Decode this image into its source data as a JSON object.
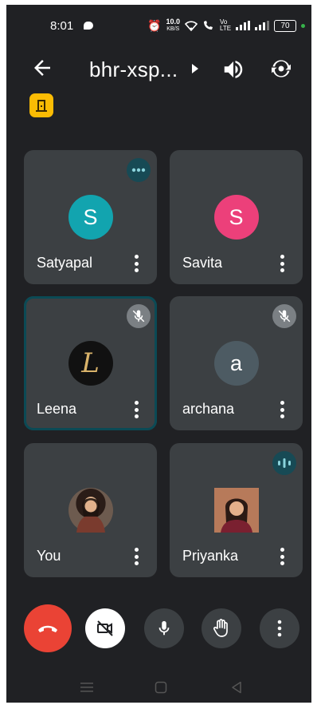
{
  "status_bar": {
    "time": "8:01",
    "net_speed_value": "10.0",
    "net_speed_unit": "KB/S",
    "volte_label": "Vo LTE",
    "battery": "70"
  },
  "header": {
    "meeting_code": "bhr-xsp..."
  },
  "participants": [
    {
      "name": "Satyapal",
      "initial": "S",
      "avatar_color": "#12a4af",
      "status": "more-dots"
    },
    {
      "name": "Savita",
      "initial": "S",
      "avatar_color": "#ec407a",
      "status": "none"
    },
    {
      "name": "Leena",
      "initial": "L",
      "avatar_color": "#111111",
      "status": "muted",
      "selected": true
    },
    {
      "name": "archana",
      "initial": "a",
      "avatar_color": "#4d5b63",
      "status": "muted"
    },
    {
      "name": "You",
      "initial": "",
      "avatar_color": "#6d5b4f",
      "status": "none"
    },
    {
      "name": "Priyanka",
      "initial": "",
      "avatar_color": "#8a4a3a",
      "status": "speaking"
    }
  ],
  "controls": [
    "end-call",
    "camera-off",
    "microphone",
    "raise-hand",
    "more-options"
  ],
  "colors": {
    "background": "#202124",
    "tile": "#3c4043",
    "end_call": "#ea4335",
    "badge_yellow": "#fbbc04",
    "accent_teal": "#0b4a55"
  }
}
